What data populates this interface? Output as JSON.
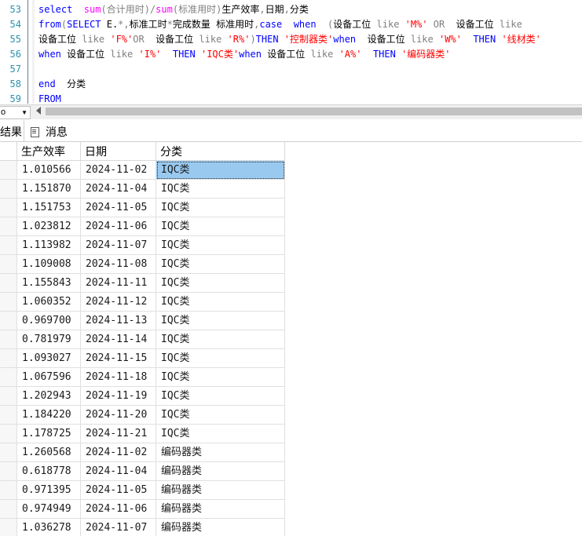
{
  "editor": {
    "lines": [
      {
        "num": "53",
        "parts": [
          {
            "t": "select  ",
            "c": "kw"
          },
          {
            "t": "sum",
            "c": "fn"
          },
          {
            "t": "(合计用时)/",
            "c": "gr"
          },
          {
            "t": "sum",
            "c": "fn"
          },
          {
            "t": "(标准用时)",
            "c": "gr"
          },
          {
            "t": "生产效率",
            "c": "plain"
          },
          {
            "t": ",",
            "c": "gr"
          },
          {
            "t": "日期",
            "c": "plain"
          },
          {
            "t": ",",
            "c": "gr"
          },
          {
            "t": "分类",
            "c": "plain"
          }
        ]
      },
      {
        "num": "54",
        "parts": [
          {
            "t": "from",
            "c": "kw"
          },
          {
            "t": "(",
            "c": "gr"
          },
          {
            "t": "SELECT ",
            "c": "kw"
          },
          {
            "t": "E.",
            "c": "plain"
          },
          {
            "t": "*,",
            "c": "gr"
          },
          {
            "t": "标准工时",
            "c": "plain"
          },
          {
            "t": "*",
            "c": "gr"
          },
          {
            "t": "完成数量 标准用时",
            "c": "plain"
          },
          {
            "t": ",",
            "c": "gr"
          },
          {
            "t": "case  when  ",
            "c": "kw"
          },
          {
            "t": "(",
            "c": "gr"
          },
          {
            "t": "设备工位 ",
            "c": "plain"
          },
          {
            "t": "like ",
            "c": "gr"
          },
          {
            "t": "'M%' ",
            "c": "st"
          },
          {
            "t": "OR  ",
            "c": "gr"
          },
          {
            "t": "设备工位 ",
            "c": "plain"
          },
          {
            "t": "like",
            "c": "gr"
          }
        ]
      },
      {
        "num": "55",
        "parts": [
          {
            "t": "设备工位 ",
            "c": "plain"
          },
          {
            "t": "like ",
            "c": "gr"
          },
          {
            "t": "'F%'",
            "c": "st"
          },
          {
            "t": "OR  ",
            "c": "gr"
          },
          {
            "t": "设备工位 ",
            "c": "plain"
          },
          {
            "t": "like ",
            "c": "gr"
          },
          {
            "t": "'R%'",
            "c": "st"
          },
          {
            "t": ")",
            "c": "gr"
          },
          {
            "t": "THEN ",
            "c": "kw"
          },
          {
            "t": "'控制器类'",
            "c": "st"
          },
          {
            "t": "when  ",
            "c": "kw"
          },
          {
            "t": "设备工位 ",
            "c": "plain"
          },
          {
            "t": "like ",
            "c": "gr"
          },
          {
            "t": "'W%'  ",
            "c": "st"
          },
          {
            "t": "THEN ",
            "c": "kw"
          },
          {
            "t": "'线材类'",
            "c": "st"
          }
        ]
      },
      {
        "num": "56",
        "parts": [
          {
            "t": "when ",
            "c": "kw"
          },
          {
            "t": "设备工位 ",
            "c": "plain"
          },
          {
            "t": "like ",
            "c": "gr"
          },
          {
            "t": "'I%'  ",
            "c": "st"
          },
          {
            "t": "THEN ",
            "c": "kw"
          },
          {
            "t": "'IQC类'",
            "c": "st"
          },
          {
            "t": "when ",
            "c": "kw"
          },
          {
            "t": "设备工位 ",
            "c": "plain"
          },
          {
            "t": "like ",
            "c": "gr"
          },
          {
            "t": "'A%'  ",
            "c": "st"
          },
          {
            "t": "THEN ",
            "c": "kw"
          },
          {
            "t": "'编码器类'",
            "c": "st"
          }
        ]
      },
      {
        "num": "57",
        "parts": []
      },
      {
        "num": "58",
        "parts": [
          {
            "t": "end  ",
            "c": "kw"
          },
          {
            "t": "分类",
            "c": "plain"
          }
        ]
      },
      {
        "num": "59",
        "parts": [
          {
            "t": "FROM",
            "c": "kw"
          }
        ]
      }
    ]
  },
  "zoom": {
    "value": "o"
  },
  "tabs": {
    "results": "结果",
    "messages": "消息"
  },
  "colors": {
    "keyword": "#0000ff",
    "function": "#ff00ff",
    "string": "#ff0000",
    "operator": "#808080",
    "selection": "#99c9ef"
  },
  "grid": {
    "columns": [
      "生产效率",
      "日期",
      "分类"
    ],
    "rows": [
      [
        "1.010566",
        "2024-11-02",
        "IQC类"
      ],
      [
        "1.151870",
        "2024-11-04",
        "IQC类"
      ],
      [
        "1.151753",
        "2024-11-05",
        "IQC类"
      ],
      [
        "1.023812",
        "2024-11-06",
        "IQC类"
      ],
      [
        "1.113982",
        "2024-11-07",
        "IQC类"
      ],
      [
        "1.109008",
        "2024-11-08",
        "IQC类"
      ],
      [
        "1.155843",
        "2024-11-11",
        "IQC类"
      ],
      [
        "1.060352",
        "2024-11-12",
        "IQC类"
      ],
      [
        "0.969700",
        "2024-11-13",
        "IQC类"
      ],
      [
        "0.781979",
        "2024-11-14",
        "IQC类"
      ],
      [
        "1.093027",
        "2024-11-15",
        "IQC类"
      ],
      [
        "1.067596",
        "2024-11-18",
        "IQC类"
      ],
      [
        "1.202943",
        "2024-11-19",
        "IQC类"
      ],
      [
        "1.184220",
        "2024-11-20",
        "IQC类"
      ],
      [
        "1.178725",
        "2024-11-21",
        "IQC类"
      ],
      [
        "1.260568",
        "2024-11-02",
        "编码器类"
      ],
      [
        "0.618778",
        "2024-11-04",
        "编码器类"
      ],
      [
        "0.971395",
        "2024-11-05",
        "编码器类"
      ],
      [
        "0.974949",
        "2024-11-06",
        "编码器类"
      ],
      [
        "1.036278",
        "2024-11-07",
        "编码器类"
      ]
    ],
    "selected_row": 0
  }
}
